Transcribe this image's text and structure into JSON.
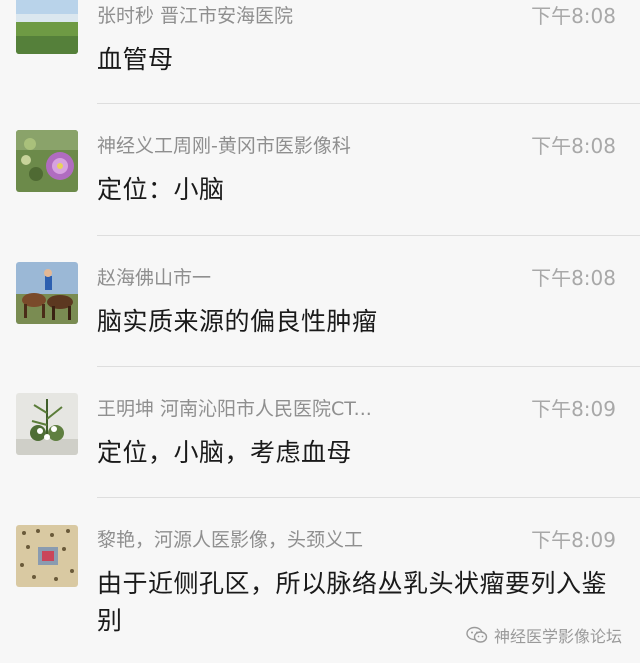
{
  "messages": [
    {
      "sender": "张时秒  晋江市安海医院",
      "time": "下午8:08",
      "content": "血管母",
      "avatar": "grassland-photo-avatar"
    },
    {
      "sender": "神经义工周刚-黄冈市医影像科",
      "time": "下午8:08",
      "content": "定位：小脑",
      "avatar": "flower-photo-avatar"
    },
    {
      "sender": "赵海佛山市一",
      "time": "下午8:08",
      "content": "脑实质来源的偏良性肿瘤",
      "avatar": "horses-photo-avatar"
    },
    {
      "sender": "王明坤  河南沁阳市人民医院CT...",
      "time": "下午8:09",
      "content": "定位，小脑，考虑血母",
      "avatar": "plant-photo-avatar"
    },
    {
      "sender": "黎艳，河源人医影像，头颈义工",
      "time": "下午8:09",
      "content": "由于近侧孔区，所以脉络丛乳头状瘤要列入鉴别",
      "avatar": "pattern-photo-avatar"
    }
  ],
  "watermark": {
    "text": "神经医学影像论坛",
    "icon": "wechat-icon"
  }
}
